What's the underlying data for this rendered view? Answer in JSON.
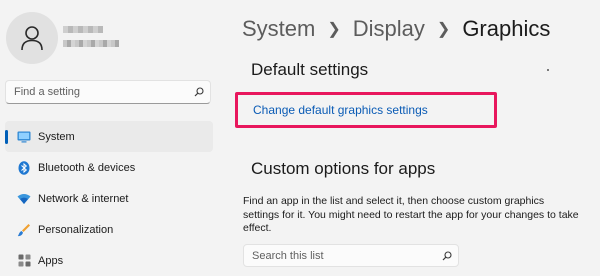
{
  "sidebar": {
    "search": {
      "placeholder": "Find a setting"
    },
    "items": [
      {
        "label": "System",
        "icon": "system-icon",
        "selected": true
      },
      {
        "label": "Bluetooth & devices",
        "icon": "bluetooth-icon",
        "selected": false
      },
      {
        "label": "Network & internet",
        "icon": "wifi-icon",
        "selected": false
      },
      {
        "label": "Personalization",
        "icon": "brush-icon",
        "selected": false
      },
      {
        "label": "Apps",
        "icon": "apps-icon",
        "selected": false
      }
    ]
  },
  "breadcrumb": [
    "System",
    "Display",
    "Graphics"
  ],
  "default_settings": {
    "heading": "Default settings",
    "link": "Change default graphics settings"
  },
  "custom_options": {
    "heading": "Custom options for apps",
    "description": "Find an app in the list and select it, then choose custom graphics settings for it. You might need to restart the app for your changes to take effect.",
    "search_placeholder": "Search this list"
  },
  "colors": {
    "accent": "#005fb8",
    "link": "#0a5bb5",
    "highlight_box": "#e8175d",
    "background": "#f3f3f3"
  }
}
